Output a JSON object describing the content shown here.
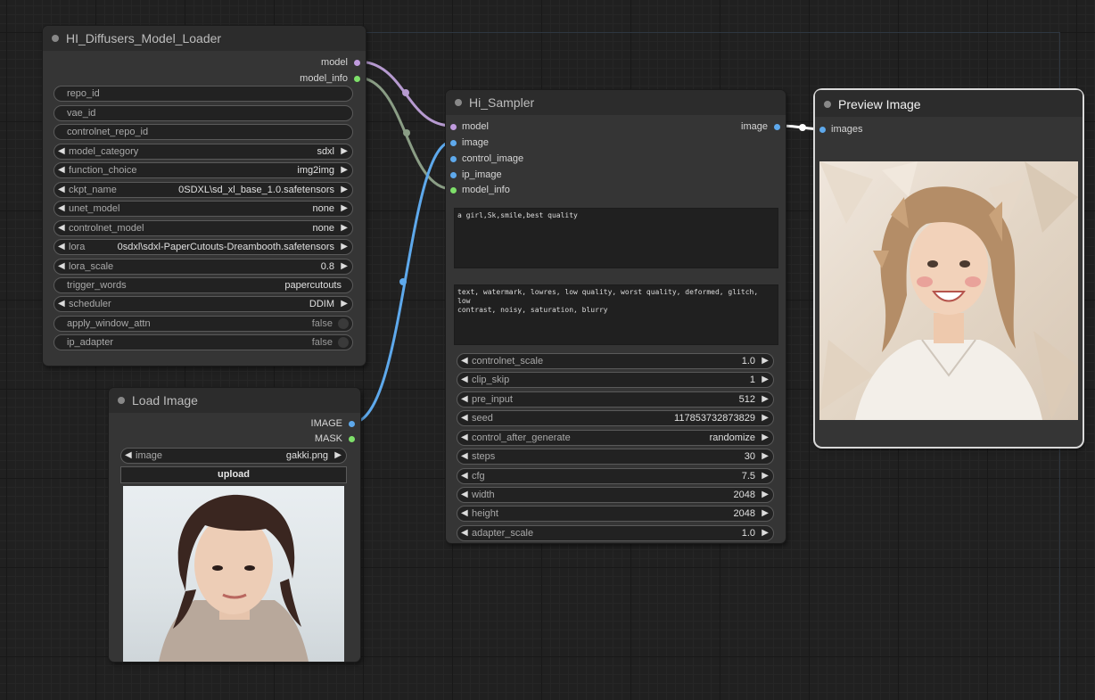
{
  "colors": {
    "model": "#c09bde",
    "model_info": "#7ee06a",
    "image": "#5ea9ec",
    "mask": "#7ee06a",
    "link_model": "#b69ad0",
    "link_info": "#8a9d85",
    "link_image": "#5ea9ec",
    "link_preview": "#ffffff"
  },
  "loader": {
    "title": "HI_Diffusers_Model_Loader",
    "outputs": {
      "model": "model",
      "model_info": "model_info"
    },
    "widgets": [
      {
        "label": "repo_id",
        "value": ""
      },
      {
        "label": "vae_id",
        "value": ""
      },
      {
        "label": "controlnet_repo_id",
        "value": ""
      },
      {
        "label": "model_category",
        "value": "sdxl"
      },
      {
        "label": "function_choice",
        "value": "img2img"
      },
      {
        "label": "ckpt_name",
        "value": "0SDXL\\sd_xl_base_1.0.safetensors"
      },
      {
        "label": "unet_model",
        "value": "none"
      },
      {
        "label": "controlnet_model",
        "value": "none"
      },
      {
        "label": "lora",
        "value": "0sdxl\\sdxl-PaperCutouts-Dreambooth.safetensors"
      },
      {
        "label": "lora_scale",
        "value": "0.8"
      },
      {
        "label": "trigger_words",
        "value": "papercutouts"
      },
      {
        "label": "scheduler",
        "value": "DDIM"
      },
      {
        "label": "apply_window_attn",
        "value": "false"
      },
      {
        "label": "ip_adapter",
        "value": "false"
      }
    ]
  },
  "load_image": {
    "title": "Load Image",
    "outputs": {
      "image": "IMAGE",
      "mask": "MASK"
    },
    "image_label": "image",
    "image_value": "gakki.png",
    "upload_label": "upload"
  },
  "sampler": {
    "title": "Hi_Sampler",
    "inputs": [
      "model",
      "image",
      "control_image",
      "ip_image",
      "model_info"
    ],
    "output": "image",
    "positive_prompt": "a girl,Sk,smile,best quality",
    "negative_prompt": "text, watermark, lowres, low quality, worst quality, deformed, glitch, low\ncontrast, noisy, saturation, blurry",
    "widgets": [
      {
        "label": "controlnet_scale",
        "value": "1.0"
      },
      {
        "label": "clip_skip",
        "value": "1"
      },
      {
        "label": "pre_input",
        "value": "512"
      },
      {
        "label": "seed",
        "value": "117853732873829"
      },
      {
        "label": "control_after_generate",
        "value": "randomize"
      },
      {
        "label": "steps",
        "value": "30"
      },
      {
        "label": "cfg",
        "value": "7.5"
      },
      {
        "label": "width",
        "value": "2048"
      },
      {
        "label": "height",
        "value": "2048"
      },
      {
        "label": "adapter_scale",
        "value": "1.0"
      }
    ]
  },
  "preview": {
    "title": "Preview Image",
    "input": "images"
  }
}
